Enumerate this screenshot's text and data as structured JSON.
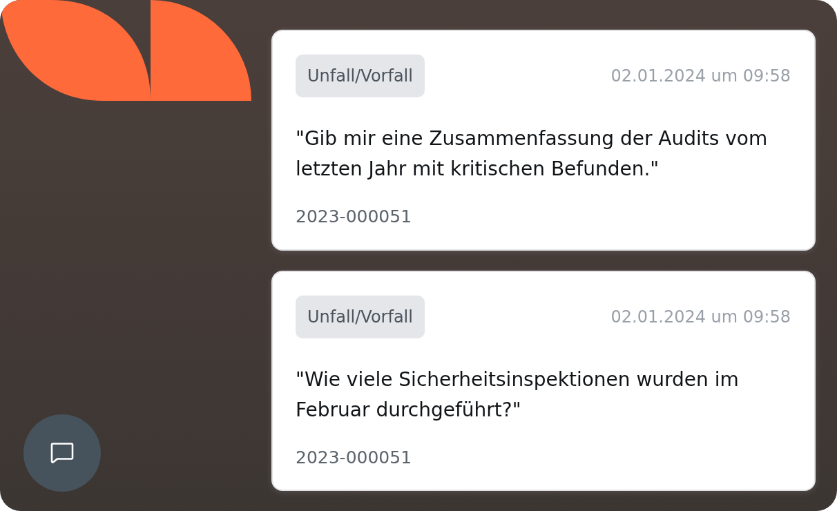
{
  "cards": [
    {
      "tag": "Unfall/Vorfall",
      "timestamp": "02.01.2024 um 09:58",
      "prompt": "\"Gib mir eine Zusammenfassung der Audits vom letzten Jahr mit kritischen Befunden.\"",
      "id": "2023-000051"
    },
    {
      "tag": "Unfall/Vorfall",
      "timestamp": "02.01.2024 um 09:58",
      "prompt": "\"Wie viele Sicherheitsinspektionen wurden im Februar durchgeführt?\"",
      "id": "2023-000051"
    }
  ]
}
